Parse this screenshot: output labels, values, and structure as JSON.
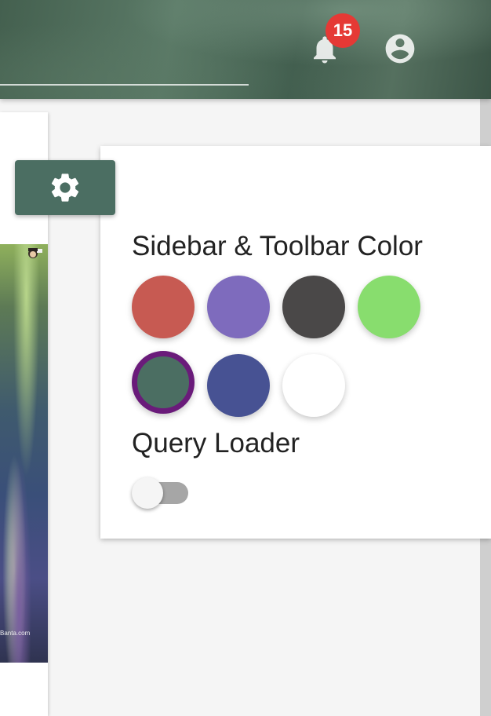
{
  "toolbar": {
    "notification_count": "15",
    "notification_icon": "bell-icon",
    "account_icon": "account-circle-icon",
    "background_color": "#4c6a58"
  },
  "left_card": {
    "watermark": "Banta.com"
  },
  "settings_button": {
    "icon": "gear-icon",
    "color": "#4b6e62"
  },
  "settings_panel": {
    "color_section_title": "Sidebar & Toolbar Color",
    "swatches": [
      {
        "name": "red",
        "color": "#c75a52",
        "selected": false
      },
      {
        "name": "purple",
        "color": "#7e6bbd",
        "selected": false
      },
      {
        "name": "dark-gray",
        "color": "#4a4848",
        "selected": false
      },
      {
        "name": "green",
        "color": "#88dd6e",
        "selected": false
      },
      {
        "name": "teal-green",
        "color": "#4b6e62",
        "selected": true
      },
      {
        "name": "indigo",
        "color": "#475293",
        "selected": false
      },
      {
        "name": "white",
        "color": "#ffffff",
        "selected": false
      }
    ],
    "selected_border_color": "#6a1b7a",
    "query_loader_title": "Query Loader",
    "query_loader_enabled": false
  }
}
